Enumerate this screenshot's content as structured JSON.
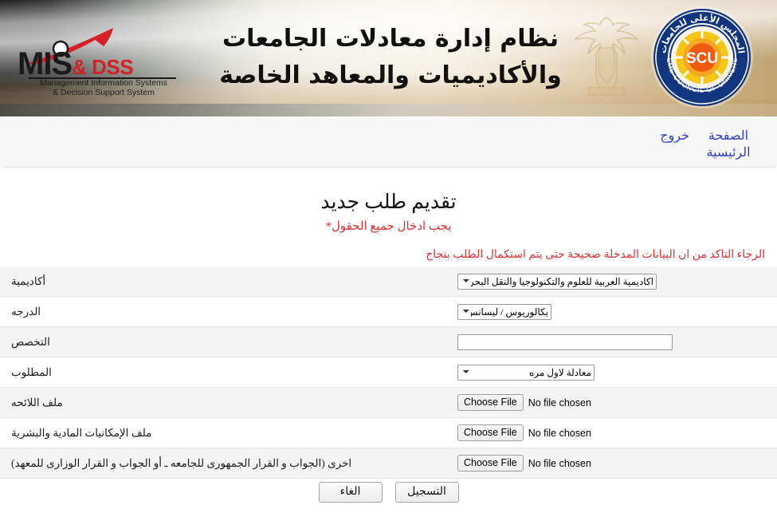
{
  "banner": {
    "title_line1": "نظام إدارة معادلات الجامعات",
    "title_line2": "والأكاديميات والمعاهد الخاصة",
    "logo": {
      "mis": "MIS",
      "dss": "& DSS",
      "subtitle_line1": "Management Information Systems",
      "subtitle_line2": "& Decision Support System"
    },
    "seal": {
      "center_text": "SCU",
      "arabic_ring": "المجلس الأعلى للجامعات",
      "english_ring": "SUPREME COUNCIL OF UNIVERSITIES"
    }
  },
  "nav": {
    "home": "الصفحة الرئيسية",
    "logout": "خروج"
  },
  "page": {
    "title": "تقديم طلب جديد",
    "required_note": "يجب ادخال جميع الحقول*",
    "confirm_note": "الرجاء التاكد من ان البيانات المدخلة صحيحة حتى يتم استكمال الطلب بنجاح"
  },
  "form": {
    "rows": [
      {
        "label": "أكاديمية",
        "type": "select",
        "value": "اكاديمية العربية للعلوم والتكنولوجيا والنقل البحري"
      },
      {
        "label": "الدرجه",
        "type": "select",
        "value": "بكالوريوس / ليسانس"
      },
      {
        "label": "التخصص",
        "type": "text",
        "value": "",
        "placeholder": ""
      },
      {
        "label": "المطلوب",
        "type": "select",
        "value": "معادلة لاول مره"
      },
      {
        "label": "ملف اللائحه",
        "type": "file",
        "button_label": "Choose File",
        "file_status": "No file chosen"
      },
      {
        "label": "ملف الإمكانيات المادية والبشرية",
        "type": "file",
        "button_label": "Choose File",
        "file_status": "No file chosen"
      },
      {
        "label": "اخرى (الجواب و القرار الجمهورى للجامعه ـ أو الجواب و القرار الوزارى للمعهد)",
        "type": "file",
        "button_label": "Choose File",
        "file_status": "No file chosen"
      }
    ]
  },
  "actions": {
    "submit": "التسجيل",
    "cancel": "الغاء"
  },
  "colors": {
    "link": "#2b3fc4",
    "alert": "#e03030",
    "logo_red": "#d42027",
    "seal_blue": "#12357f",
    "seal_orange": "#f07c12"
  }
}
